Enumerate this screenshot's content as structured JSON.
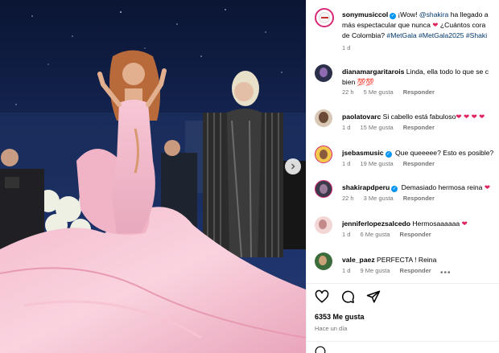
{
  "post": {
    "author": "sonymusiccol",
    "caption_line1": "¡Wow! ",
    "caption_mention": "@shakira",
    "caption_line1_end": " ha llegado a",
    "caption_line2": "más espectacular que nunca ",
    "caption_line2_heart": "❤",
    "caption_line2_end": "¿Cuántos cora",
    "caption_line3_pre": "de Colombia? ",
    "hashtags": "#MetGala #MetGala2025 #Shaki",
    "time": "1 d"
  },
  "comments": [
    {
      "user": "dianamargaritarois",
      "text": "Linda, ella todo lo que se c",
      "text2": "bien 💯💯",
      "time": "22 h",
      "likes": "5 Me gusta",
      "reply": "Responder",
      "verified": false
    },
    {
      "user": "paolatovarc",
      "text": "Si cabello está fabuloso",
      "hearts": "❤ ❤ ❤ ❤",
      "time": "1 d",
      "likes": "15 Me gusta",
      "reply": "Responder",
      "verified": false
    },
    {
      "user": "jsebasmusic",
      "text": "Que queeeee? Esto es posible?",
      "time": "1 d",
      "likes": "19 Me gusta",
      "reply": "Responder",
      "verified": true
    },
    {
      "user": "shakirapdperu",
      "text": "Demasiado hermosa reina",
      "hearts": "❤",
      "time": "22 h",
      "likes": "3 Me gusta",
      "reply": "Responder",
      "verified": true
    },
    {
      "user": "jenniferlopezsalcedo",
      "text": "Hermosaaaaaa",
      "hearts": "❤",
      "time": "1 d",
      "likes": "6 Me gusta",
      "reply": "Responder",
      "verified": false
    },
    {
      "user": "vale_paez",
      "text": "PERFECTA ! Reina",
      "time": "1 d",
      "likes": "9 Me gusta",
      "reply": "Responder",
      "verified": false
    }
  ],
  "footer": {
    "likes": "6353 Me gusta",
    "time": "Hace un día"
  },
  "colors": {
    "accent": "#0095f6",
    "link": "#00376b",
    "heart": "#e0245e",
    "muted": "#737373"
  }
}
